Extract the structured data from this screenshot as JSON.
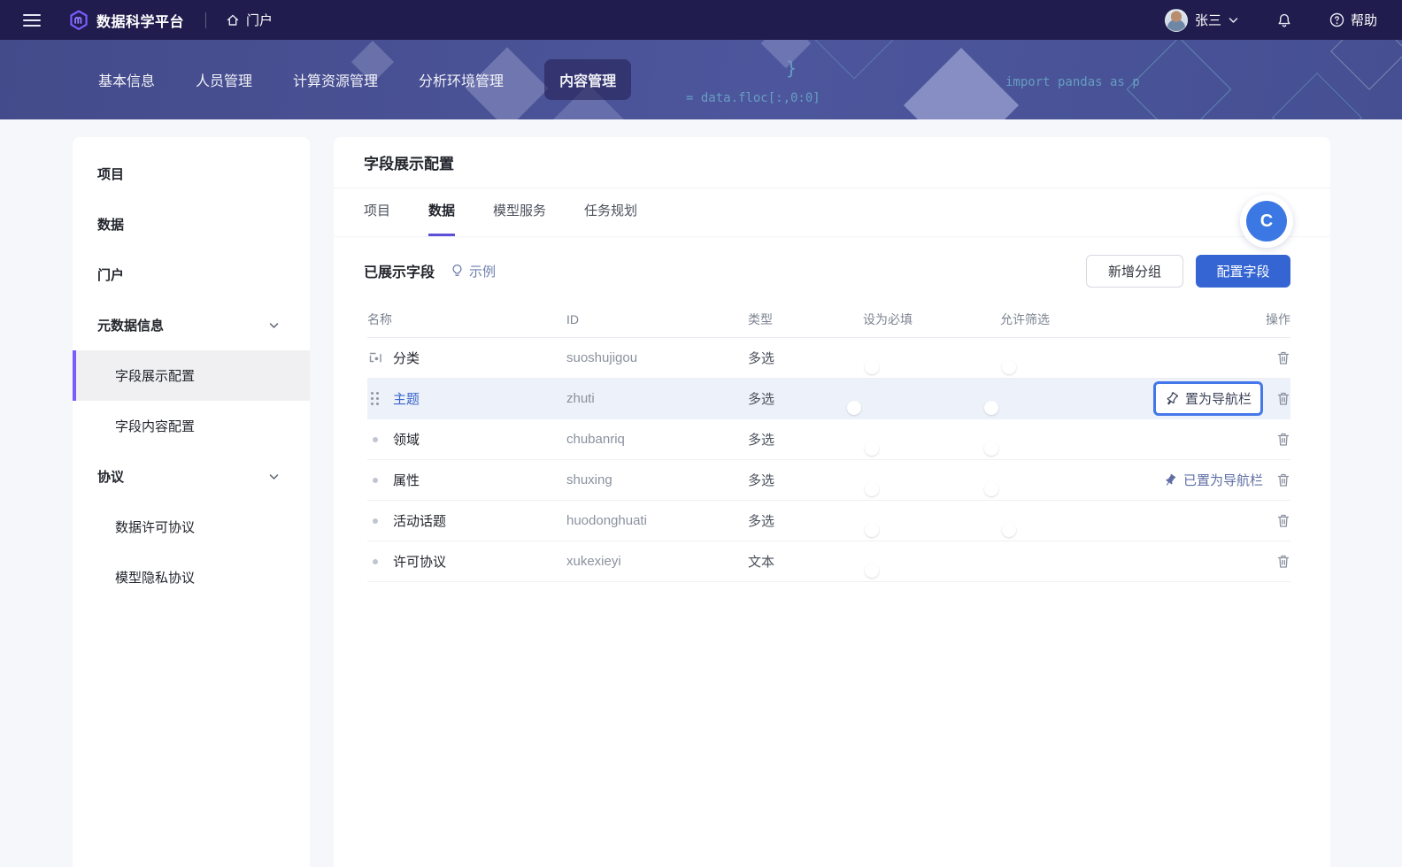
{
  "topbar": {
    "product_name": "数据科学平台",
    "portal_label": "门户",
    "user_name": "张三",
    "help_label": "帮助"
  },
  "banner": {
    "code_snippets": [
      "import pandas as p",
      "= data.floc[:,0:0]",
      ".floc[:,0:0]",
      "}"
    ],
    "tabs": [
      {
        "label": "基本信息",
        "active": false
      },
      {
        "label": "人员管理",
        "active": false
      },
      {
        "label": "计算资源管理",
        "active": false
      },
      {
        "label": "分析环境管理",
        "active": false
      },
      {
        "label": "内容管理",
        "active": true
      }
    ]
  },
  "sidebar": {
    "items": [
      {
        "label": "项目",
        "type": "top",
        "group": false,
        "active": false
      },
      {
        "label": "数据",
        "type": "top",
        "group": false,
        "active": false
      },
      {
        "label": "门户",
        "type": "top",
        "group": false,
        "active": false
      },
      {
        "label": "元数据信息",
        "type": "top",
        "group": true,
        "active": false
      },
      {
        "label": "字段展示配置",
        "type": "sub",
        "group": false,
        "active": true
      },
      {
        "label": "字段内容配置",
        "type": "sub",
        "group": false,
        "active": false
      },
      {
        "label": "协议",
        "type": "top",
        "group": true,
        "active": false
      },
      {
        "label": "数据许可协议",
        "type": "sub",
        "group": false,
        "active": false
      },
      {
        "label": "模型隐私协议",
        "type": "sub",
        "group": false,
        "active": false
      }
    ]
  },
  "main": {
    "title": "字段展示配置",
    "tabs": [
      {
        "label": "项目",
        "active": false
      },
      {
        "label": "数据",
        "active": true
      },
      {
        "label": "模型服务",
        "active": false
      },
      {
        "label": "任务规划",
        "active": false
      }
    ],
    "section": {
      "title": "已展示字段",
      "example_label": "示例",
      "add_group_label": "新增分组",
      "configure_fields_label": "配置字段",
      "coachmark_letter": "C"
    },
    "table": {
      "headers": {
        "name": "名称",
        "id": "ID",
        "type": "类型",
        "required": "设为必填",
        "filterable": "允许筛选",
        "action": "操作"
      },
      "rows": [
        {
          "name": "分类",
          "link": false,
          "icon": "category",
          "id": "suoshujigou",
          "type": "多选",
          "required": false,
          "filterable": false,
          "nav": "none",
          "nav_label": "",
          "selected": false
        },
        {
          "name": "主题",
          "link": true,
          "icon": "drag",
          "id": "zhuti",
          "type": "多选",
          "required": true,
          "filterable": true,
          "nav": "set",
          "nav_label": "置为导航栏",
          "selected": true
        },
        {
          "name": "领域",
          "link": false,
          "icon": "dot",
          "id": "chubanriq",
          "type": "多选",
          "required": false,
          "filterable": true,
          "nav": "none",
          "nav_label": "",
          "selected": false
        },
        {
          "name": "属性",
          "link": false,
          "icon": "dot",
          "id": "shuxing",
          "type": "多选",
          "required": false,
          "filterable": true,
          "nav": "pinned",
          "nav_label": "已置为导航栏",
          "selected": false
        },
        {
          "name": "活动话题",
          "link": false,
          "icon": "dot",
          "id": "huodonghuati",
          "type": "多选",
          "required": false,
          "filterable": false,
          "nav": "none",
          "nav_label": "",
          "selected": false
        },
        {
          "name": "许可协议",
          "link": false,
          "icon": "dot",
          "id": "xukexieyi",
          "type": "文本",
          "required": false,
          "filterable": null,
          "nav": "none",
          "nav_label": "",
          "selected": false
        }
      ]
    }
  },
  "colors": {
    "topbar_bg": "#201c4d",
    "banner_bg": "#4a5294",
    "accent_purple": "#7a5cff",
    "primary_blue": "#3465d2",
    "toggle_on": "#2b52cb",
    "highlight_border": "#4478ea",
    "link_blue": "#3a66cc",
    "pinned_text": "#5f6fa5"
  }
}
